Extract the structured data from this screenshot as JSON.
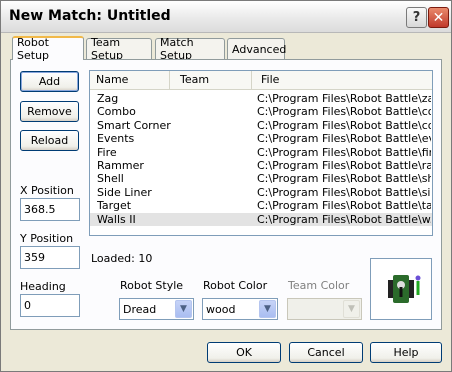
{
  "window": {
    "title": "New Match: Untitled",
    "help_glyph": "?",
    "close_glyph": "✕"
  },
  "tabs": [
    {
      "label": "Robot Setup",
      "active": true
    },
    {
      "label": "Team Setup",
      "active": false
    },
    {
      "label": "Match Setup",
      "active": false
    },
    {
      "label": "Advanced",
      "active": false
    }
  ],
  "side": {
    "add_label": "Add",
    "remove_label": "Remove",
    "reload_label": "Reload",
    "x_position_label": "X Position",
    "x_position_value": "368.5",
    "y_position_label": "Y Position",
    "y_position_value": "359",
    "heading_label": "Heading",
    "heading_value": "0"
  },
  "list": {
    "columns": [
      "Name",
      "Team",
      "File"
    ],
    "rows": [
      {
        "name": "Zag",
        "team": "",
        "file": "C:\\Program Files\\Robot Battle\\za..."
      },
      {
        "name": "Combo",
        "team": "",
        "file": "C:\\Program Files\\Robot Battle\\co..."
      },
      {
        "name": "Smart Corner",
        "team": "",
        "file": "C:\\Program Files\\Robot Battle\\co..."
      },
      {
        "name": "Events",
        "team": "",
        "file": "C:\\Program Files\\Robot Battle\\ev..."
      },
      {
        "name": "Fire",
        "team": "",
        "file": "C:\\Program Files\\Robot Battle\\fir..."
      },
      {
        "name": "Rammer",
        "team": "",
        "file": "C:\\Program Files\\Robot Battle\\ra..."
      },
      {
        "name": "Shell",
        "team": "",
        "file": "C:\\Program Files\\Robot Battle\\sh..."
      },
      {
        "name": "Side Liner",
        "team": "",
        "file": "C:\\Program Files\\Robot Battle\\sid..."
      },
      {
        "name": "Target",
        "team": "",
        "file": "C:\\Program Files\\Robot Battle\\tar..."
      },
      {
        "name": "Walls II",
        "team": "",
        "file": "C:\\Program Files\\Robot Battle\\w..."
      }
    ],
    "selected_index": 9,
    "loaded_text": "Loaded: 10"
  },
  "style": {
    "robot_style_label": "Robot Style",
    "robot_style_value": "Dread",
    "robot_color_label": "Robot Color",
    "robot_color_value": "wood",
    "team_color_label": "Team Color",
    "team_color_value": ""
  },
  "footer": {
    "ok_label": "OK",
    "cancel_label": "Cancel",
    "help_label": "Help"
  },
  "colors": {
    "dialog_bg": "#ece9d8",
    "selection": "#e3e3e3",
    "robot_body": "#2b6b2b",
    "robot_accent": "#6a4fd6"
  }
}
